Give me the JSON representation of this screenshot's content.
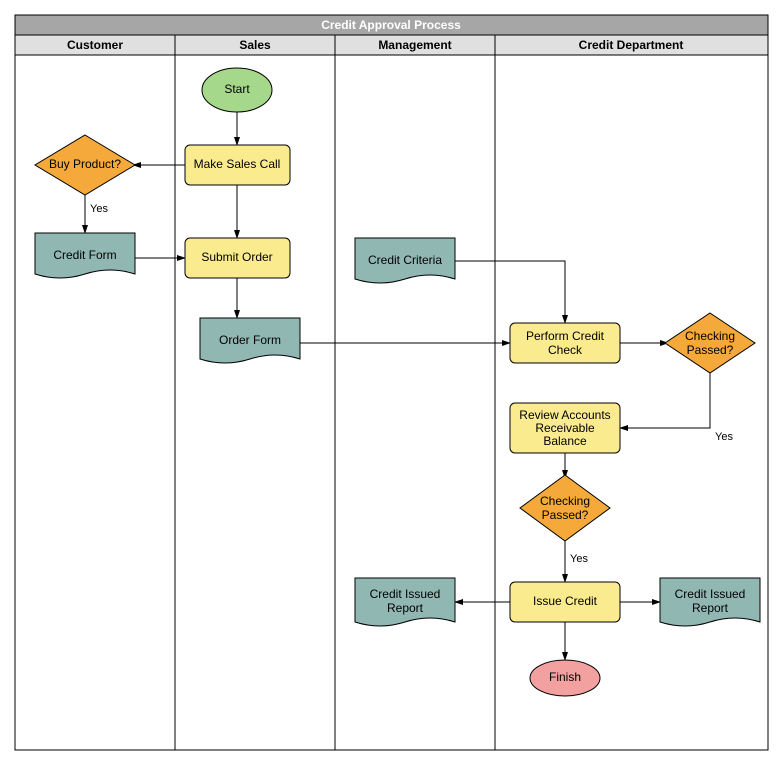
{
  "title": "Credit Approval Process",
  "lanes": {
    "l1": "Customer",
    "l2": "Sales",
    "l3": "Management",
    "l4": "Credit Department"
  },
  "nodes": {
    "start": "Start",
    "makeSalesCall": "Make Sales Call",
    "buyProduct": "Buy Product?",
    "creditForm": "Credit Form",
    "submitOrder": "Submit Order",
    "orderForm": "Order Form",
    "creditCriteria": "Credit Criteria",
    "performCreditCheck1": "Perform Credit",
    "performCreditCheck2": "Check",
    "checkingPassed1a": "Checking",
    "checkingPassed1b": "Passed?",
    "reviewAR1": "Review Accounts",
    "reviewAR2": "Receivable",
    "reviewAR3": "Balance",
    "checkingPassed2a": "Checking",
    "checkingPassed2b": "Passed?",
    "issueCredit": "Issue Credit",
    "creditIssuedReport1a": "Credit Issued",
    "creditIssuedReport1b": "Report",
    "creditIssuedReport2a": "Credit Issued",
    "creditIssuedReport2b": "Report",
    "finish": "Finish"
  },
  "edges": {
    "yes1": "Yes",
    "yes2": "Yes",
    "yes3": "Yes"
  }
}
